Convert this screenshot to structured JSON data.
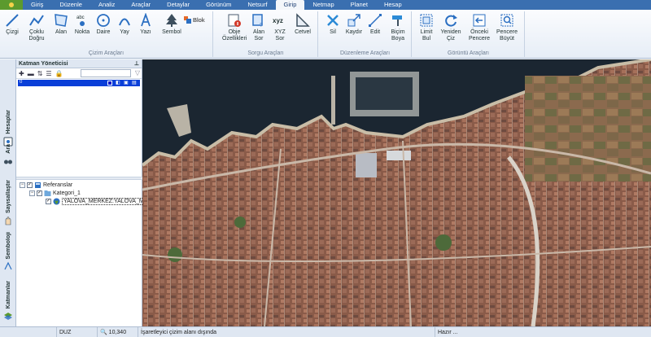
{
  "menu": {
    "tabs": [
      "Giriş",
      "Düzenle",
      "Analiz",
      "Araçlar",
      "Detaylar",
      "Görünüm",
      "Netsurf",
      "Girip",
      "Netmap",
      "Planet",
      "Hesap"
    ],
    "active_tab": "Girip"
  },
  "ribbon": {
    "groups": {
      "cizim": {
        "label": "Çizim Araçları",
        "buttons": [
          "Çizgi",
          "Çoklu Doğru",
          "Alan",
          "Nokta",
          "Daire",
          "Yay",
          "Yazı",
          "Sembol"
        ],
        "nokta_caption": "abc",
        "blok": "Blok"
      },
      "sorgu": {
        "label": "Sorgu Araçları",
        "buttons": [
          "Obje Özellikleri",
          "Alan Sor",
          "XYZ Sor",
          "Cetvel"
        ],
        "xyz_caption": "xyz"
      },
      "duzenleme": {
        "label": "Düzenleme Araçları",
        "buttons": [
          "Sil",
          "Kaydır",
          "Edit",
          "Biçim Boya"
        ]
      },
      "gorunum": {
        "label": "Görüntü Araçları",
        "buttons": [
          "Limit Bul",
          "Yeniden Çiz",
          "Önceki Pencere",
          "Pencere Büyüt"
        ]
      }
    }
  },
  "side_tabs": [
    "Hesaplar",
    "Ara",
    "Sayısallaştır",
    "Semboloji",
    "Katmanlar"
  ],
  "layer_panel": {
    "title": "Katman Yöneticisi",
    "selected_layer_index": "0",
    "tree": {
      "root": "Referanslar",
      "category": "Kategori_1",
      "item": "YALOVA_MERKEZ:YALOVA_MI"
    }
  },
  "status": {
    "mode": "DUZ",
    "zoom": "10,340",
    "message": "İşaretleyici çizim alanı dışında",
    "ready": "Hazır ..."
  },
  "colors": {
    "menubar": "#3a6fb0",
    "selection": "#0a3fd8",
    "sea": "#1b2631"
  }
}
